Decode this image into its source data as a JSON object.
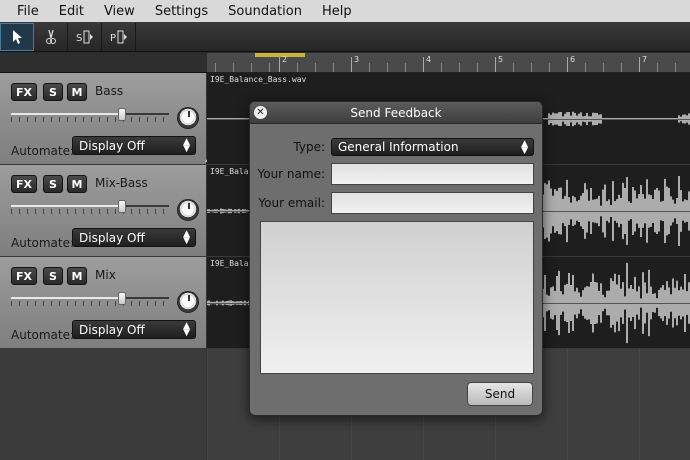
{
  "menu": [
    "File",
    "Edit",
    "View",
    "Settings",
    "Soundation",
    "Help"
  ],
  "toolbar": {
    "tools": [
      {
        "name": "pointer-tool",
        "icon": "pointer-icon",
        "active": true
      },
      {
        "name": "cut-tool",
        "icon": "scissors-icon",
        "active": false
      },
      {
        "name": "stretch-tool",
        "icon": "stretch-icon",
        "active": false
      },
      {
        "name": "pitch-tool",
        "icon": "pitch-icon",
        "active": false
      }
    ]
  },
  "ruler": {
    "numbers": [
      "2",
      "3",
      "4",
      "5",
      "6",
      "7"
    ]
  },
  "tracks": [
    {
      "name": "Bass",
      "fx": "FX",
      "solo": "S",
      "mute": "M",
      "automate_label": "Automate:",
      "automate_value": "Display Off",
      "volume": 0.7,
      "clip_label": "I9E_Balance_Bass.wav"
    },
    {
      "name": "Mix-Bass",
      "fx": "FX",
      "solo": "S",
      "mute": "M",
      "automate_label": "Automate:",
      "automate_value": "Display Off",
      "volume": 0.7,
      "clip_label": "I9E_Balanc"
    },
    {
      "name": "Mix",
      "fx": "FX",
      "solo": "S",
      "mute": "M",
      "automate_label": "Automate:",
      "automate_value": "Display Off",
      "volume": 0.7,
      "clip_label": "I9E_Balanc"
    }
  ],
  "dialog": {
    "title": "Send Feedback",
    "close_icon": "close-icon",
    "type_label": "Type:",
    "type_value": "General Information",
    "name_label": "Your name:",
    "name_value": "",
    "email_label": "Your email:",
    "email_value": "",
    "message_value": "",
    "send_label": "Send"
  },
  "colors": {
    "accent": "#4a7a9c",
    "loop": "#c9b33a",
    "waveform": "#d0d0d0"
  }
}
